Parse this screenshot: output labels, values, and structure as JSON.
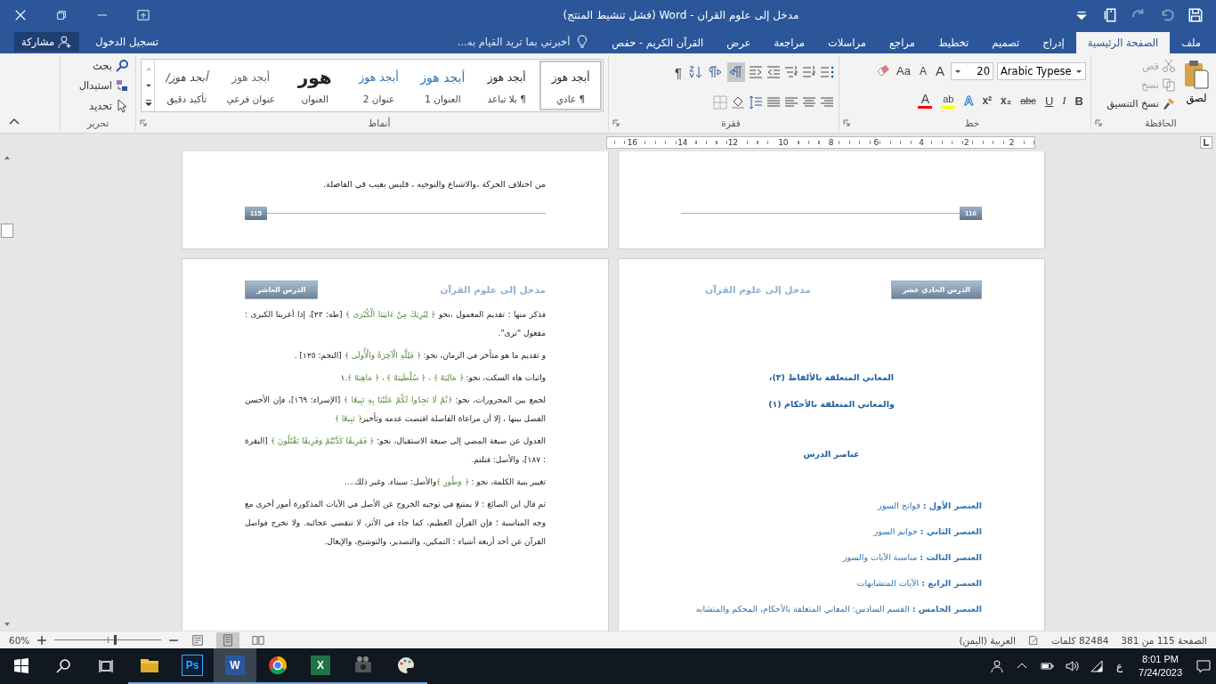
{
  "title_bar": {
    "title": "مدخل إلى علوم القران - Word (فشل تنشيط المنتج)"
  },
  "tabs": [
    {
      "label": "ملف",
      "selected": false
    },
    {
      "label": "الصفحة الرئيسية",
      "selected": true
    },
    {
      "label": "إدراج",
      "selected": false
    },
    {
      "label": "تصميم",
      "selected": false
    },
    {
      "label": "تخطيط",
      "selected": false
    },
    {
      "label": "مراجع",
      "selected": false
    },
    {
      "label": "مراسلات",
      "selected": false
    },
    {
      "label": "مراجعة",
      "selected": false
    },
    {
      "label": "عرض",
      "selected": false
    },
    {
      "label": "القرآن الكريم - حفص",
      "selected": false
    }
  ],
  "tell_me": {
    "placeholder": "أخبرني بما تريد القيام به..."
  },
  "sign_in": "تسجيل الدخول",
  "share": "مشاركة",
  "clipboard": {
    "label": "الحافظة",
    "paste": "لصق",
    "items": [
      {
        "kind": "cut",
        "label": "قص",
        "disabled": true
      },
      {
        "kind": "copy",
        "label": "نسخ",
        "disabled": true
      },
      {
        "kind": "format-painter",
        "label": "نسخ التنسيق",
        "disabled": false
      }
    ]
  },
  "font": {
    "label": "خط",
    "name": "Arabic Typese",
    "size": "20",
    "case_button": "Aa",
    "size_buttons": [
      {
        "kind": "grow",
        "label": "A"
      },
      {
        "kind": "shrink",
        "label": "A"
      }
    ],
    "format_buttons": [
      {
        "kind": "bold",
        "label": "B"
      },
      {
        "kind": "italic",
        "label": "I"
      },
      {
        "kind": "underline",
        "label": "U"
      },
      {
        "kind": "strike",
        "label": "abc"
      },
      {
        "kind": "subscript",
        "label": "x₂"
      },
      {
        "kind": "superscript",
        "label": "x²"
      }
    ],
    "color_buttons": [
      {
        "kind": "effects",
        "label": "A"
      },
      {
        "kind": "highlight",
        "label": "ab",
        "color": "#ffff00"
      },
      {
        "kind": "font-color",
        "label": "A",
        "color": "#ff0000"
      }
    ]
  },
  "paragraph": {
    "label": "فقرة",
    "show_marks": "¶",
    "direction": [
      {
        "kind": "rtl",
        "selected": true
      },
      {
        "kind": "ltr",
        "selected": false
      }
    ]
  },
  "styles": {
    "label": "أنماط",
    "items": [
      {
        "kind": "normal",
        "preview": "أبجد هوز",
        "name": "¶ عادي",
        "selected": true
      },
      {
        "kind": "no-spacing",
        "preview": "أبجد هوز",
        "name": "¶ بلا تباعد",
        "selected": false
      },
      {
        "kind": "heading1",
        "preview": "أبجد هوز",
        "name": "العنوان 1",
        "selected": false
      },
      {
        "kind": "heading2",
        "preview": "أبجد هوز",
        "name": "عنوان 2",
        "selected": false
      },
      {
        "kind": "title",
        "preview": "هور",
        "name": "العنوان",
        "selected": false
      },
      {
        "kind": "subtitle",
        "preview": "أبجد هوز",
        "name": "عنوان فرعي",
        "selected": false
      },
      {
        "kind": "subtle-emphasis",
        "preview": "أبجد هوز/",
        "name": "تأكيد دقيق",
        "selected": false
      }
    ]
  },
  "editing": {
    "label": "تحرير",
    "items": [
      {
        "kind": "find",
        "label": "بحث"
      },
      {
        "kind": "replace",
        "label": "استبدال"
      },
      {
        "kind": "select",
        "label": "تحديد"
      }
    ]
  },
  "ruler": {
    "numbers": [
      "2",
      "2",
      "4",
      "6",
      "8",
      "10",
      "12",
      "14",
      "16"
    ]
  },
  "document": {
    "top_pages": [
      {
        "page_number": "116"
      },
      {
        "line": "من اختلاف الحركة ،والاشباع والتوجيه ، فليس بعيب في الفاصلة.",
        "page_number": "115"
      }
    ],
    "bottom_pages": [
      {
        "tag": "الدرس الحادي عشر",
        "header": "مدخل إلى علوم القرآن",
        "titles": [
          "المعاني المتعلقة بالألفاظ (٣)،",
          "والمعاني المتعلقة بالأحكام (١)"
        ],
        "section_title": "عناصر الدرس",
        "elements": [
          "**العنصر الأول :** فواتح السور",
          "**العنصر الثاني :** خواتم السور",
          "**العنصر الثالث :** مناسبة الآيات والسور",
          "**العنصر الرابع :** الآيات المتشابهات",
          "**العنصر الخامس :** القسم السادس: المعاني المتعلقة بالأحكام، المحكم والمتشابه"
        ]
      },
      {
        "tag": "الدرس العاشر",
        "header": "مدخل إلى علوم القرآن",
        "paragraphs": [
          [
            {
              "kind": "plain",
              "text": "فذكر منها : تقديم المعمول ،نحو "
            },
            {
              "kind": "quran",
              "text": "﴿ لِنُرِيَكَ مِنْ ءَايَتِنَا الْكُبْرَى ﴾"
            },
            {
              "kind": "plain",
              "text": " [طه: ٢٣]، إذا أعربنا الكبرى : مفعول \"ترى\"."
            }
          ],
          [
            {
              "kind": "plain",
              "text": "و تقديم ما هو متأخر في الزمان، نحو: "
            },
            {
              "kind": "quran",
              "text": "﴿ فَلِلَّهِ الْآخِرَةُ وَالْأُولَى ﴾"
            },
            {
              "kind": "plain",
              "text": " [النجم: ١٢٥] ."
            }
          ],
          [
            {
              "kind": "plain",
              "text": "واثبات هاء السكت، نحو: "
            },
            {
              "kind": "quran",
              "text": "﴿ مَالِيَهْ ﴾ ، ﴿ سُلْطَنِيَهْ ﴾ ، ﴿ مَاهِيَهْ ﴾"
            },
            {
              "kind": "plain",
              "text": ".١"
            }
          ],
          [
            {
              "kind": "plain",
              "text": "لجمع بين المجرورات، نحو: "
            },
            {
              "kind": "quran",
              "text": "﴿ثُمَّ لَا تَجِدُوا لَكُمْ عَلَيْنَا بِهِ تَبِيعًا ﴾"
            },
            {
              "kind": "plain",
              "text": " [الإسراء: ١٦٩]، فإن الأحسن الفصل بينها ، إلا أن مراعاة الفاصلة اقتضت عدمه وتأخير"
            },
            {
              "kind": "quran",
              "text": "﴿ تَبِيعًا ﴾"
            }
          ],
          [
            {
              "kind": "plain",
              "text": "العدول عن صيغة المضي إلى صيغة الاستقبال، نحو: "
            },
            {
              "kind": "quran",
              "text": "﴿ فَفَرِيقًا كَذَّبْتُمْ وَفَرِيقًا تَقْتُلُونَ ﴾"
            },
            {
              "kind": "plain",
              "text": " [البقرة : ١٨٧]، والأصل: قتلتم."
            }
          ],
          [
            {
              "kind": "plain",
              "text": "تغيير بنية الكلمة، نحو : "
            },
            {
              "kind": "quran",
              "text": "﴿ وَطُورِ ﴾"
            },
            {
              "kind": "plain",
              "text": "والأصل: سيناء. وغير ذلك...."
            }
          ],
          [
            {
              "kind": "plain",
              "text": "ثم قال ابن الصائغ : لا يمتنع في توجيه الخروج عن الأصل في الآيات المذكورة أمور أخرى مع وجه المناسبة ؛ فإن القرآن العظيم، كما جاء في الأثر، لا تنقضي عجائبه. ولا تخرج فواصل القرآن عن أحد أربعة أشياء : التمكين، والتصدير، والتوشيح، والإيغال."
            }
          ]
        ]
      }
    ]
  },
  "status_bar": {
    "page": "الصفحة 115 من 381",
    "words": "82484 كلمات",
    "language": "العربية (اليمن)",
    "zoom": "60%",
    "zoom_slider": {
      "level": 0.56
    },
    "views": [
      {
        "kind": "web",
        "selected": false
      },
      {
        "kind": "print",
        "selected": true
      },
      {
        "kind": "read",
        "selected": false
      }
    ]
  },
  "taskbar": {
    "apps": [
      {
        "kind": "paint",
        "active": false
      },
      {
        "kind": "video",
        "active": false
      },
      {
        "kind": "excel",
        "label": "X",
        "active": false
      },
      {
        "kind": "chrome",
        "active": false
      },
      {
        "kind": "word",
        "label": "W",
        "active": true
      },
      {
        "kind": "photoshop",
        "label": "Ps",
        "active": false
      },
      {
        "kind": "explorer",
        "active": false
      }
    ],
    "ime": "ع",
    "time": "8:01 PM",
    "date": "7/24/2023"
  }
}
